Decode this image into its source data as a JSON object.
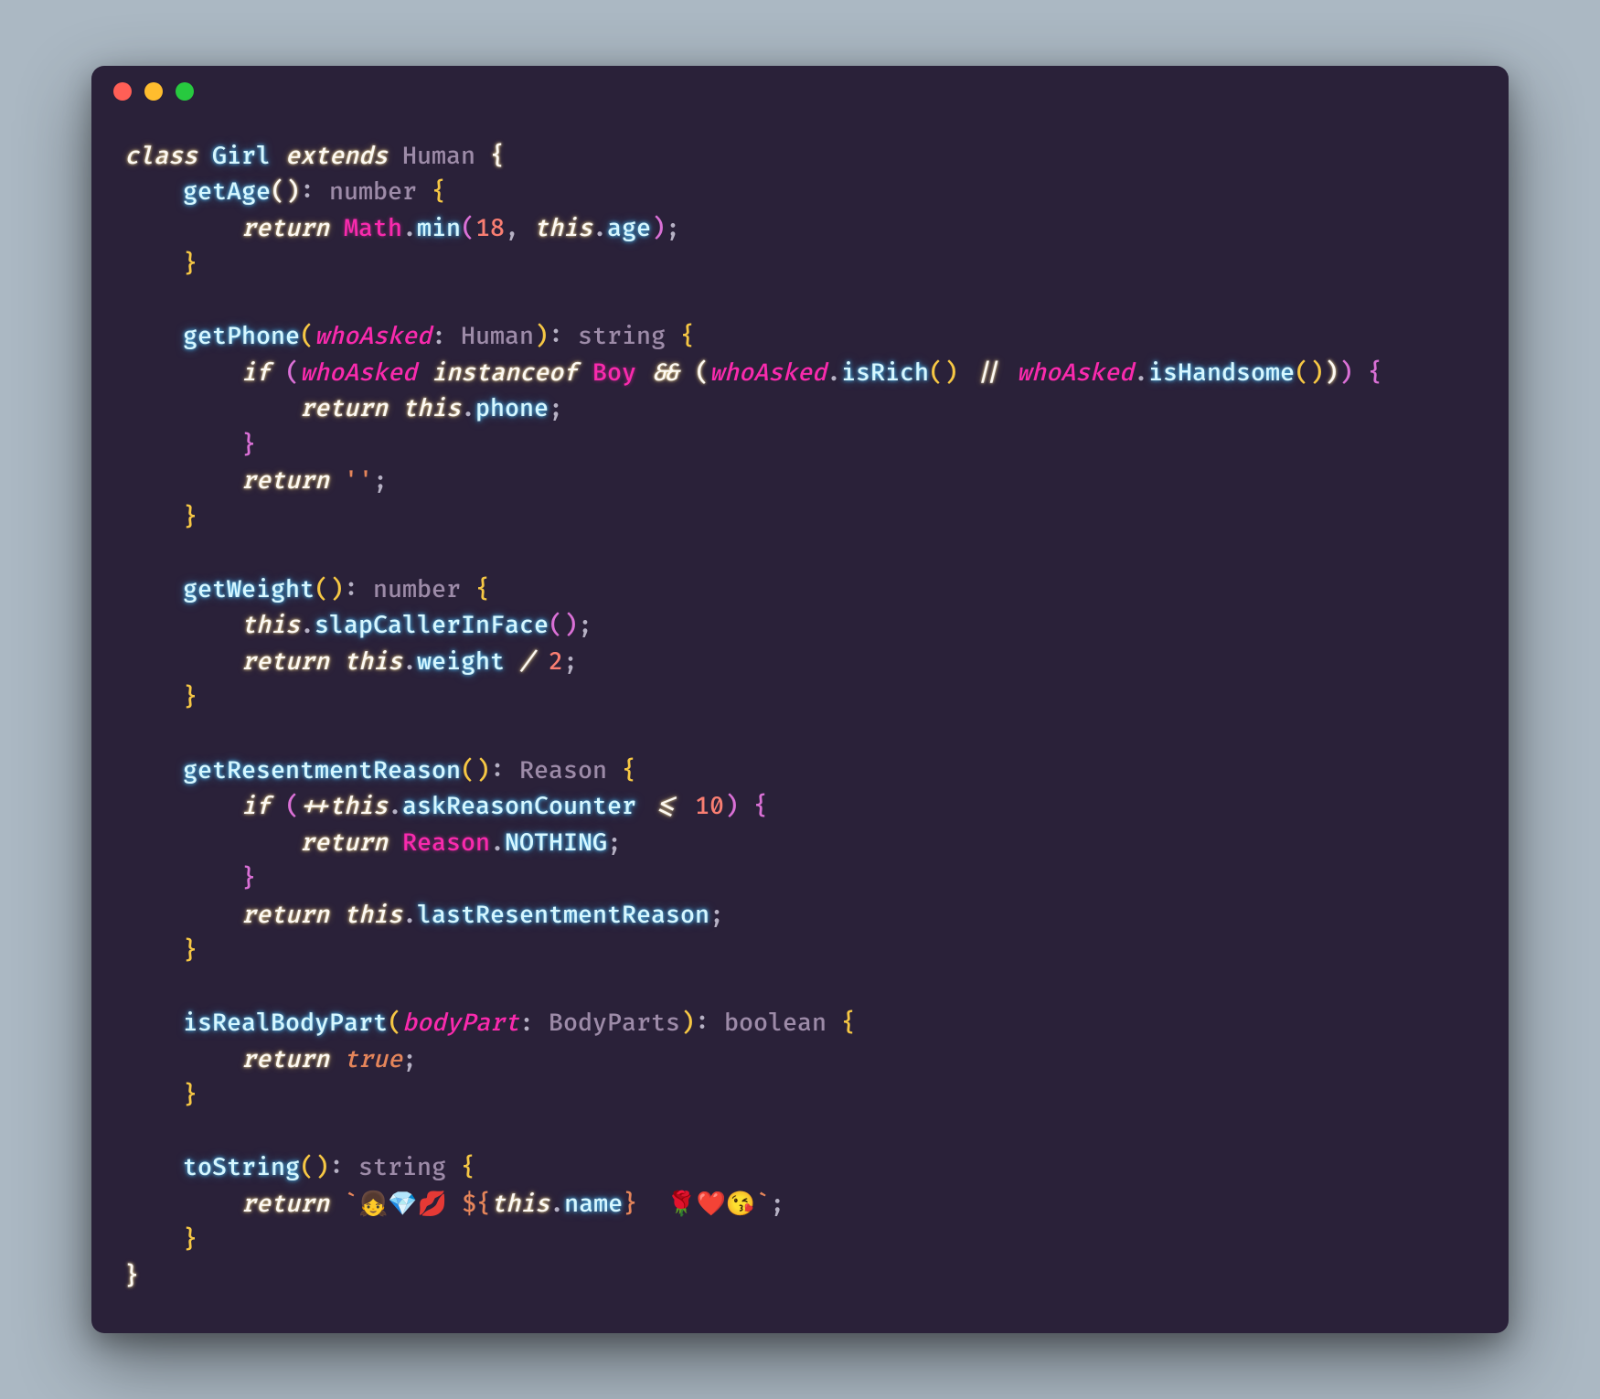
{
  "window": {
    "buttons": [
      "close",
      "minimize",
      "zoom"
    ]
  },
  "code": {
    "language": "typescript",
    "tokens": {
      "kw_class": "class",
      "kw_extends": "extends",
      "kw_return": "return",
      "kw_if": "if",
      "kw_this": "this",
      "kw_instanceof": "instanceof",
      "kw_true": "true",
      "cls_Girl": "Girl",
      "cls_Human": "Human",
      "cls_Math": "Math",
      "cls_Boy": "Boy",
      "cls_Reason": "Reason",
      "cls_BodyParts": "BodyParts",
      "ty_number": "number",
      "ty_string": "string",
      "ty_boolean": "boolean",
      "ty_Reason": "Reason",
      "m_getAge": "getAge",
      "m_getPhone": "getPhone",
      "m_getWeight": "getWeight",
      "m_getResentmentReason": "getResentmentReason",
      "m_isRealBodyPart": "isRealBodyPart",
      "m_toString": "toString",
      "m_min": "min",
      "m_isRich": "isRich",
      "m_isHandsome": "isHandsome",
      "m_slapCallerInFace": "slapCallerInFace",
      "p_whoAsked": "whoAsked",
      "p_bodyPart": "bodyPart",
      "prop_age": "age",
      "prop_phone": "phone",
      "prop_weight": "weight",
      "prop_askReasonCounter": "askReasonCounter",
      "prop_NOTHING": "NOTHING",
      "prop_lastResentmentReason": "lastResentmentReason",
      "prop_name": "name",
      "num_18": "18",
      "num_2": "2",
      "num_10": "10",
      "str_empty": "''",
      "tmpl_open": "`👧💎💋 ${",
      "tmpl_close": "}  🌹❤️😘`",
      "op_and": "&&",
      "op_or": "||",
      "op_inc": "++",
      "op_lte": "<=",
      "op_div": "/"
    }
  }
}
